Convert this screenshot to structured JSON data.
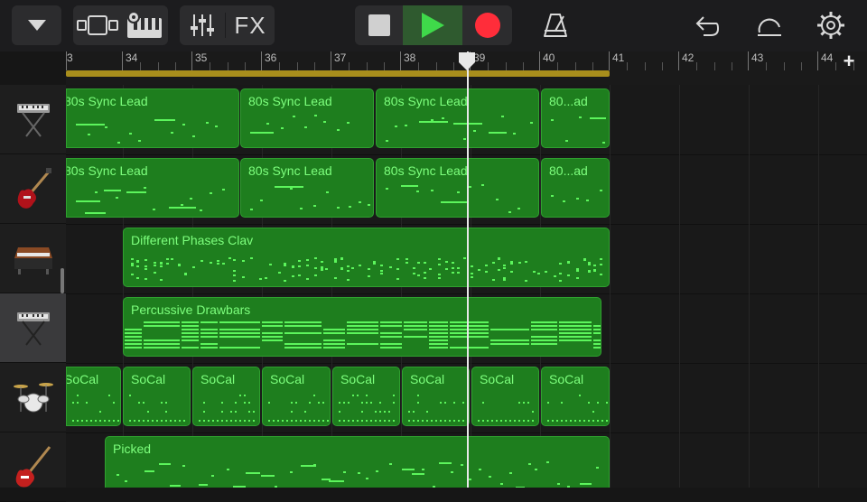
{
  "toolbar": {
    "fx_label": "FX",
    "icons": [
      "browser-dropdown-icon",
      "tracks-view-icon",
      "smart-controls-icon",
      "mixer-icon",
      "stop-icon",
      "play-icon",
      "record-icon",
      "metronome-icon",
      "undo-icon",
      "loops-icon",
      "settings-icon"
    ]
  },
  "ruler": {
    "bar_numbers": [
      "3",
      "34",
      "35",
      "36",
      "37",
      "38",
      "39",
      "40",
      "41",
      "42",
      "43",
      "44"
    ],
    "add_label": "+"
  },
  "tracks": [
    {
      "instrument_icon": "synth-keyboard-icon",
      "regions": [
        {
          "name": "80s Sync Lead"
        },
        {
          "name": "80s Sync Lead"
        },
        {
          "name": "80s Sync Lead"
        },
        {
          "name": "80...ad"
        }
      ]
    },
    {
      "instrument_icon": "electric-guitar-icon",
      "regions": [
        {
          "name": "80s Sync Lead"
        },
        {
          "name": "80s Sync Lead"
        },
        {
          "name": "80s Sync Lead"
        },
        {
          "name": "80...ad"
        }
      ]
    },
    {
      "instrument_icon": "clavinet-icon",
      "regions": [
        {
          "name": "Different Phases Clav"
        }
      ]
    },
    {
      "instrument_icon": "organ-keyboard-icon",
      "selected": true,
      "regions": [
        {
          "name": "Percussive Drawbars"
        }
      ]
    },
    {
      "instrument_icon": "drum-kit-icon",
      "regions": [
        {
          "name": "SoCal"
        },
        {
          "name": "SoCal"
        },
        {
          "name": "SoCal"
        },
        {
          "name": "SoCal"
        },
        {
          "name": "SoCal"
        },
        {
          "name": "SoCal"
        },
        {
          "name": "SoCal"
        },
        {
          "name": "SoCal"
        }
      ]
    },
    {
      "instrument_icon": "bass-guitar-icon",
      "regions": [
        {
          "name": "Picked"
        }
      ]
    }
  ],
  "colors": {
    "region_fill": "#1e7e1e",
    "region_border": "#2fa02f",
    "region_text": "#7dff7d",
    "note": "#5cf55c",
    "cycle": "#a88e1c",
    "play": "#3fd94a",
    "record": "#ff2d3a"
  }
}
